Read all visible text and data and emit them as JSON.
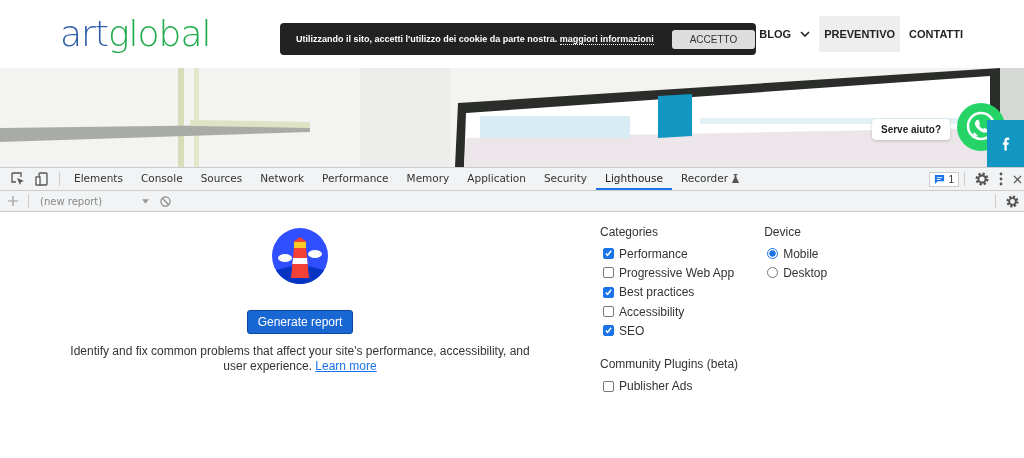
{
  "site": {
    "logo": {
      "part1": "art",
      "part2": "global"
    },
    "nav": [
      {
        "label": "BLOG",
        "dropdown": true,
        "selected": false
      },
      {
        "label": "PREVENTIVO",
        "dropdown": false,
        "selected": true
      },
      {
        "label": "CONTATTI",
        "dropdown": false,
        "selected": false
      }
    ],
    "cookie_banner": {
      "text": "Utilizzando il sito, accetti l'utilizzo dei cookie da parte nostra.",
      "link": "maggiori informazioni",
      "button": "ACCETTO"
    },
    "chat_bubble": "Serve aiuto?"
  },
  "devtools": {
    "tabs": [
      {
        "label": "Elements",
        "selected": false
      },
      {
        "label": "Console",
        "selected": false
      },
      {
        "label": "Sources",
        "selected": false
      },
      {
        "label": "Network",
        "selected": false
      },
      {
        "label": "Performance",
        "selected": false
      },
      {
        "label": "Memory",
        "selected": false
      },
      {
        "label": "Application",
        "selected": false
      },
      {
        "label": "Security",
        "selected": false
      },
      {
        "label": "Lighthouse",
        "selected": true
      },
      {
        "label": "Recorder",
        "selected": false
      }
    ],
    "issues_count": "1",
    "report_select": "(new report)",
    "generate_button": "Generate report",
    "description": "Identify and fix common problems that affect your site's performance, accessibility, and user experience.",
    "learn_more": "Learn more",
    "categories_title": "Categories",
    "categories": [
      {
        "label": "Performance",
        "checked": true
      },
      {
        "label": "Progressive Web App",
        "checked": false
      },
      {
        "label": "Best practices",
        "checked": true
      },
      {
        "label": "Accessibility",
        "checked": false
      },
      {
        "label": "SEO",
        "checked": true
      }
    ],
    "device_title": "Device",
    "devices": [
      {
        "label": "Mobile",
        "selected": true
      },
      {
        "label": "Desktop",
        "selected": false
      }
    ],
    "plugins_title": "Community Plugins (beta)",
    "plugins": [
      {
        "label": "Publisher Ads",
        "checked": false
      }
    ]
  }
}
